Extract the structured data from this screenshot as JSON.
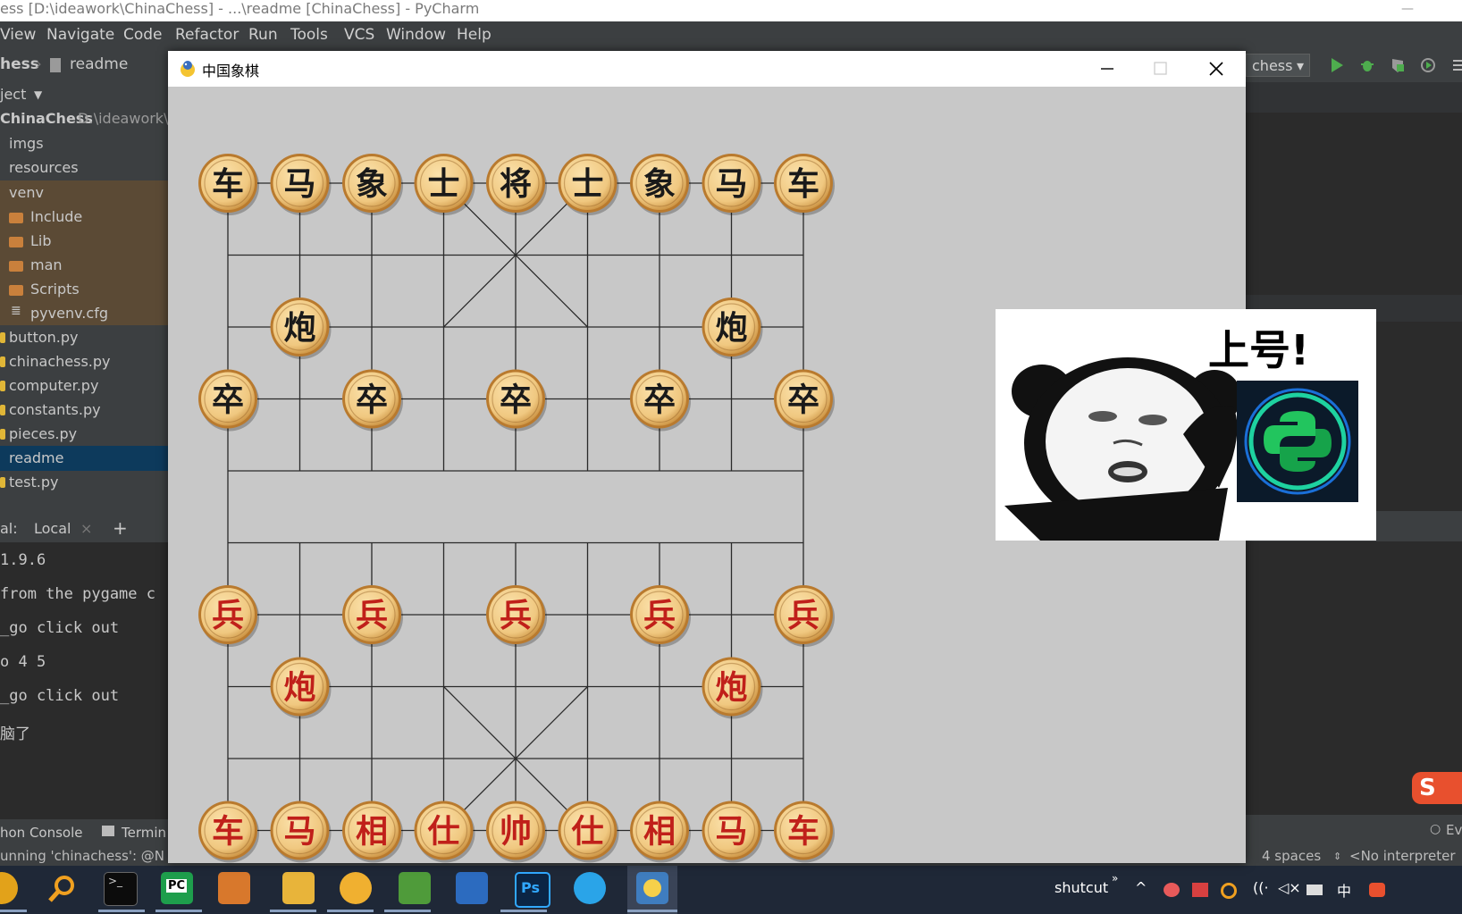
{
  "ide": {
    "title": "ess [D:\\ideawork\\ChinaChess] - ...\\readme [ChinaChess] - PyCharm",
    "menu": [
      "View",
      "Navigate",
      "Code",
      "Refactor",
      "Run",
      "Tools",
      "VCS",
      "Window",
      "Help"
    ],
    "breadcrumb": [
      "hess",
      "readme"
    ],
    "run_config": "chess",
    "project_label": "ject",
    "tree": [
      {
        "label": "ChinaChess",
        "sub": "D:\\ideawork\\",
        "type": "root"
      },
      {
        "label": "imgs",
        "type": "dir"
      },
      {
        "label": "resources",
        "type": "dir"
      },
      {
        "label": "venv",
        "type": "venv"
      },
      {
        "label": "Include",
        "type": "folder"
      },
      {
        "label": "Lib",
        "type": "folder"
      },
      {
        "label": "man",
        "type": "folder"
      },
      {
        "label": "Scripts",
        "type": "folder"
      },
      {
        "label": "pyvenv.cfg",
        "type": "cfg"
      },
      {
        "label": "button.py",
        "type": "py"
      },
      {
        "label": "chinachess.py",
        "type": "py"
      },
      {
        "label": "computer.py",
        "type": "py"
      },
      {
        "label": "constants.py",
        "type": "py"
      },
      {
        "label": "pieces.py",
        "type": "py"
      },
      {
        "label": "readme",
        "type": "selected"
      },
      {
        "label": "test.py",
        "type": "py"
      }
    ],
    "terminal_tab_prefix": "al:",
    "terminal_tab": "Local",
    "terminal_lines": [
      "1.9.6",
      "from the pygame c",
      "_go click out",
      "o 4 5",
      "_go click out",
      "脑了"
    ],
    "bottom_tabs": [
      "hon Console",
      "Termin"
    ],
    "status_left": "unning 'chinachess': @N",
    "status_indent": "4 spaces",
    "status_interpreter": "<No interpreter",
    "right_edge": "Ev"
  },
  "game": {
    "window_title": "中国象棋",
    "meme_caption": "上号!",
    "board": {
      "cols": 9,
      "rows": 10,
      "line_color": "#2a2a2a",
      "bg": "#c8c8c8"
    },
    "pieces": [
      {
        "ch": "车",
        "side": "black",
        "c": 0,
        "r": 0
      },
      {
        "ch": "马",
        "side": "black",
        "c": 1,
        "r": 0
      },
      {
        "ch": "象",
        "side": "black",
        "c": 2,
        "r": 0
      },
      {
        "ch": "士",
        "side": "black",
        "c": 3,
        "r": 0
      },
      {
        "ch": "将",
        "side": "black",
        "c": 4,
        "r": 0
      },
      {
        "ch": "士",
        "side": "black",
        "c": 5,
        "r": 0
      },
      {
        "ch": "象",
        "side": "black",
        "c": 6,
        "r": 0
      },
      {
        "ch": "马",
        "side": "black",
        "c": 7,
        "r": 0
      },
      {
        "ch": "车",
        "side": "black",
        "c": 8,
        "r": 0
      },
      {
        "ch": "炮",
        "side": "black",
        "c": 1,
        "r": 2
      },
      {
        "ch": "炮",
        "side": "black",
        "c": 7,
        "r": 2
      },
      {
        "ch": "卒",
        "side": "black",
        "c": 0,
        "r": 3
      },
      {
        "ch": "卒",
        "side": "black",
        "c": 2,
        "r": 3
      },
      {
        "ch": "卒",
        "side": "black",
        "c": 4,
        "r": 3
      },
      {
        "ch": "卒",
        "side": "black",
        "c": 6,
        "r": 3
      },
      {
        "ch": "卒",
        "side": "black",
        "c": 8,
        "r": 3
      },
      {
        "ch": "兵",
        "side": "red",
        "c": 0,
        "r": 6
      },
      {
        "ch": "兵",
        "side": "red",
        "c": 2,
        "r": 6
      },
      {
        "ch": "兵",
        "side": "red",
        "c": 4,
        "r": 6
      },
      {
        "ch": "兵",
        "side": "red",
        "c": 6,
        "r": 6
      },
      {
        "ch": "兵",
        "side": "red",
        "c": 8,
        "r": 6
      },
      {
        "ch": "炮",
        "side": "red",
        "c": 1,
        "r": 7
      },
      {
        "ch": "炮",
        "side": "red",
        "c": 7,
        "r": 7
      },
      {
        "ch": "车",
        "side": "red",
        "c": 0,
        "r": 9
      },
      {
        "ch": "马",
        "side": "red",
        "c": 1,
        "r": 9
      },
      {
        "ch": "相",
        "side": "red",
        "c": 2,
        "r": 9
      },
      {
        "ch": "仕",
        "side": "red",
        "c": 3,
        "r": 9
      },
      {
        "ch": "帅",
        "side": "red",
        "c": 4,
        "r": 9
      },
      {
        "ch": "仕",
        "side": "red",
        "c": 5,
        "r": 9
      },
      {
        "ch": "相",
        "side": "red",
        "c": 6,
        "r": 9
      },
      {
        "ch": "马",
        "side": "red",
        "c": 7,
        "r": 9
      },
      {
        "ch": "车",
        "side": "red",
        "c": 8,
        "r": 9
      }
    ],
    "colors": {
      "black_text": "#1a1a1a",
      "red_text": "#c0201a",
      "piece_face": "#f0c880",
      "piece_rim": "#b97a2e"
    }
  },
  "taskbar": {
    "tray_label": "shutcut",
    "ime": "中"
  }
}
